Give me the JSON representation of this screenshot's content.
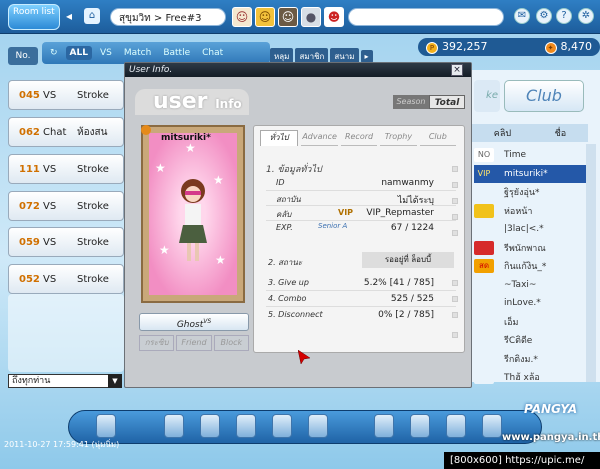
{
  "topbar": {
    "logo_label": "Room list",
    "room_title": "สุขุมวิท > Free#3",
    "money_pang": "392,257",
    "money_cookie": "8,470"
  },
  "filter": {
    "no_label": "No.",
    "tabs": [
      "ALL",
      "VS",
      "Match",
      "Battle",
      "Chat"
    ],
    "sort_buttons": [
      "หลุม",
      "สมาชิก",
      "สนาม"
    ]
  },
  "rooms": [
    {
      "num": "045",
      "type": "VS",
      "desc": "Stroke"
    },
    {
      "num": "062",
      "type": "Chat",
      "desc": "ห้องสน"
    },
    {
      "num": "111",
      "type": "VS",
      "desc": "Stroke"
    },
    {
      "num": "072",
      "type": "VS",
      "desc": "Stroke"
    },
    {
      "num": "059",
      "type": "VS",
      "desc": "Stroke"
    },
    {
      "num": "052",
      "type": "VS",
      "desc": "Stroke"
    }
  ],
  "chat": {
    "channel": "ถึงทุกท่าน"
  },
  "right_panel": {
    "make_label": "ke",
    "club_label": "Club",
    "col_rank": "คลิป",
    "col_name": "ชื่อ",
    "players": [
      {
        "rank": "NO",
        "name": "Time",
        "rank_color": "#ffffff",
        "text_color": "#666666"
      },
      {
        "rank": "VIP",
        "name": "mitsuriki*",
        "rank_color": "#2458a8",
        "text_color": "#ffe36b"
      },
      {
        "rank": "",
        "name": "ฐิรุยังอุ่น*",
        "rank_color": "#e9f3fb",
        "text_color": "#333333"
      },
      {
        "rank": "",
        "name": "ห่อหน้า",
        "rank_color": "#f1c21b",
        "text_color": "#333333"
      },
      {
        "rank": "",
        "name": "|3lac|<.*",
        "rank_color": "#e9f3fb",
        "text_color": "#333333"
      },
      {
        "rank": "",
        "name": "รีพนักพาณ",
        "rank_color": "#d62b2b",
        "text_color": "#333333"
      },
      {
        "rank": "สด",
        "name": "กินแก้งิน_*",
        "rank_color": "#f2a000",
        "text_color": "#d00000"
      },
      {
        "rank": "",
        "name": "~Taxi~",
        "rank_color": "#e9f3fb",
        "text_color": "#333333"
      },
      {
        "rank": "",
        "name": "inLove.*",
        "rank_color": "#e9f3fb",
        "text_color": "#333333"
      },
      {
        "rank": "",
        "name": "เอ็ม",
        "rank_color": "#e9f3fb",
        "text_color": "#333333"
      },
      {
        "rank": "",
        "name": "รีCติดีe",
        "rank_color": "#e9f3fb",
        "text_color": "#333333"
      },
      {
        "rank": "",
        "name": "รีกติงม.*",
        "rank_color": "#e9f3fb",
        "text_color": "#333333"
      },
      {
        "rank": "",
        "name": "Thฮ้ xล้อ",
        "rank_color": "#e9f3fb",
        "text_color": "#333333"
      }
    ]
  },
  "dialog": {
    "title": "User Info.",
    "logo_user": "user",
    "logo_info": "Info",
    "season_label": "Season",
    "total_label": "Total",
    "char_name": "mitsuriki*",
    "tabs": [
      "ทั่วไป",
      "Advance",
      "Record",
      "Trophy",
      "Club"
    ],
    "general_header": "1. ข้อมูลทั่วไป",
    "fields": [
      {
        "label": "ID",
        "value": "namwanmy"
      },
      {
        "label": "สถาบัน",
        "value": "ไม่ได้ระบุ"
      },
      {
        "label": "คลับ",
        "value": "VIP_Repmaster"
      },
      {
        "label": "EXP.",
        "value": "67 / 1224"
      }
    ],
    "vip_mark": "VIP",
    "senior_label": "Senior A",
    "status_label": "2. สถานะ",
    "status_value": "รออยู่ที่ ล็อบบี้",
    "stats": [
      {
        "label": "3. Give up",
        "value": "5.2% [41 / 785]"
      },
      {
        "label": "4. Combo",
        "value": "525 / 525"
      },
      {
        "label": "5. Disconnect",
        "value": "0% [2 / 785]"
      }
    ],
    "ghost_label": "Ghost",
    "ghost_sup": "VS",
    "action_buttons": [
      "กระซิบ",
      "Friend",
      "Block"
    ]
  },
  "bottom": {
    "datestamp": "2011-10-27 17:59:41 (นุ่มนิ่ม)",
    "brand": "PANGYA",
    "website": "www.pangya.in.th",
    "caption": "[800x600] https://upic.me/"
  }
}
